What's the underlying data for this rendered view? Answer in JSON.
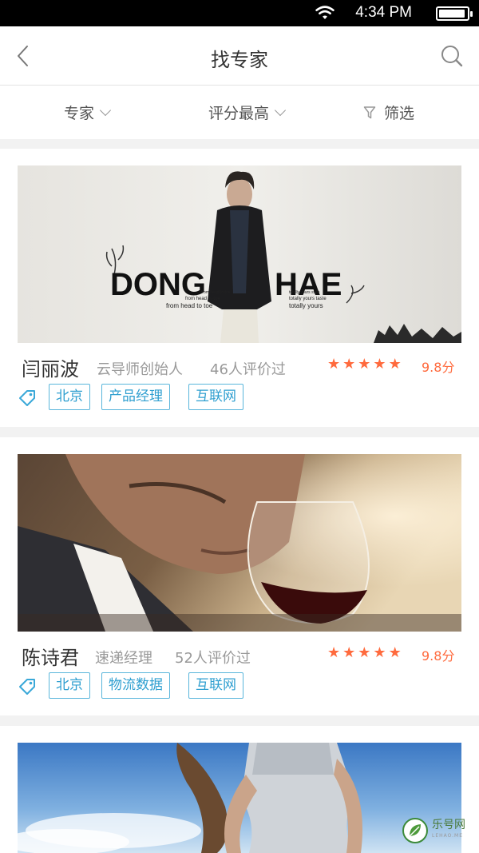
{
  "status_bar": {
    "time": "4:34 PM",
    "battery_level": 0.95
  },
  "header": {
    "title": "找专家"
  },
  "filters": {
    "expert": "专家",
    "rating": "评分最高",
    "screen": "筛选"
  },
  "experts": [
    {
      "name": "闫丽波",
      "role": "云导师创始人",
      "reviews": "46人评价过",
      "rating_stars": 5,
      "score": "9.8分",
      "tags": [
        "北京",
        "产品经理",
        "互联网"
      ],
      "photo_text": {
        "headline": "DONG HAE",
        "left_small": [
          "from head to toe",
          "from head to toe",
          "from head to toe"
        ],
        "right_small": [
          "totally yours style",
          "totally yours taste",
          "totally yours"
        ]
      }
    },
    {
      "name": "陈诗君",
      "role": "速递经理",
      "reviews": "52人评价过",
      "rating_stars": 5,
      "score": "9.8分",
      "tags": [
        "北京",
        "物流数据",
        "互联网"
      ]
    }
  ],
  "watermark": {
    "name": "乐号网",
    "sub": "LEHAO.ME"
  },
  "colors": {
    "accent": "#ff6a3d",
    "tag": "#2f9fd0",
    "tag_border": "#5ab6db"
  }
}
